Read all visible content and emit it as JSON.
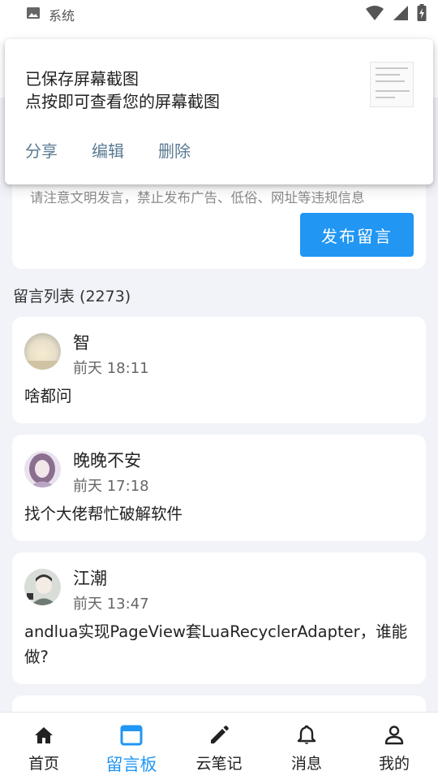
{
  "status_bar": {
    "app_label": "系统",
    "icons": [
      "image-icon",
      "wifi-icon",
      "signal-icon",
      "battery-charging-icon"
    ]
  },
  "composer": {
    "notice": "请注意文明发言，禁止发布广告、低俗、网址等违规信息",
    "publish_label": "发布留言"
  },
  "notification": {
    "title": "已保存屏幕截图",
    "subtitle": "点按即可查看您的屏幕截图",
    "actions": [
      {
        "label": "分享"
      },
      {
        "label": "编辑"
      },
      {
        "label": "删除"
      }
    ]
  },
  "list": {
    "header": "留言列表 (2273)",
    "messages": [
      {
        "name": "智",
        "time": "前天 18:11",
        "content": "啥都问"
      },
      {
        "name": "晚晚不安",
        "time": "前天 17:18",
        "content": "找个大佬帮忙破解软件"
      },
      {
        "name": "江潮",
        "time": "前天 13:47",
        "content": "andlua实现PageView套LuaRecyclerAdapter，谁能做?"
      }
    ]
  },
  "bottom_nav": {
    "active_index": 1,
    "accent_color": "#2196f3",
    "items": [
      {
        "label": "首页",
        "icon": "home-icon"
      },
      {
        "label": "留言板",
        "icon": "message-board-icon"
      },
      {
        "label": "云笔记",
        "icon": "pencil-icon"
      },
      {
        "label": "消息",
        "icon": "bell-icon"
      },
      {
        "label": "我的",
        "icon": "person-icon"
      }
    ]
  }
}
